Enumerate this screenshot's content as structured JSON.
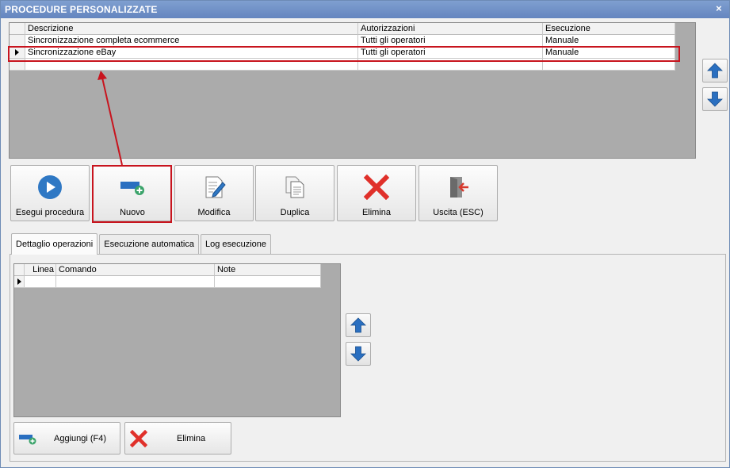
{
  "window": {
    "title": "PROCEDURE PERSONALIZZATE",
    "close_glyph": "×"
  },
  "procedures_grid": {
    "columns": [
      "Descrizione",
      "Autorizzazioni",
      "Esecuzione"
    ],
    "rows": [
      {
        "descrizione": "Sincronizzazione completa ecommerce",
        "autorizzazioni": "Tutti gli operatori",
        "esecuzione": "Manuale",
        "selected": false
      },
      {
        "descrizione": "Sincronizzazione eBay",
        "autorizzazioni": "Tutti gli operatori",
        "esecuzione": "Manuale",
        "selected": true
      },
      {
        "descrizione": "",
        "autorizzazioni": "",
        "esecuzione": "",
        "selected": false
      }
    ]
  },
  "toolbar": {
    "run_label": "Esegui procedura",
    "new_label": "Nuovo",
    "edit_label": "Modifica",
    "duplicate_label": "Duplica",
    "delete_label": "Elimina",
    "exit_label": "Uscita (ESC)"
  },
  "tabs": [
    {
      "label": "Dettaglio operazioni",
      "active": true
    },
    {
      "label": "Esecuzione automatica",
      "active": false
    },
    {
      "label": "Log esecuzione",
      "active": false
    }
  ],
  "operations_grid": {
    "columns": [
      "Linea",
      "Comando",
      "Note"
    ],
    "rows": [
      {
        "linea": "",
        "comando": "",
        "note": ""
      }
    ]
  },
  "bottom_buttons": {
    "add_label": "Aggiungi (F4)",
    "delete_label": "Elimina"
  },
  "icons": {
    "run": "play-icon",
    "new": "add-module-icon",
    "edit": "edit-document-icon",
    "duplicate": "duplicate-icon",
    "delete": "red-x-icon",
    "exit": "exit-door-icon",
    "up": "arrow-up-icon",
    "down": "arrow-down-icon"
  },
  "colors": {
    "title_bar": "#6f90c7",
    "highlight": "#c8141e",
    "arrow_blue": "#2a6fc0",
    "grid_bg": "#ababab"
  }
}
